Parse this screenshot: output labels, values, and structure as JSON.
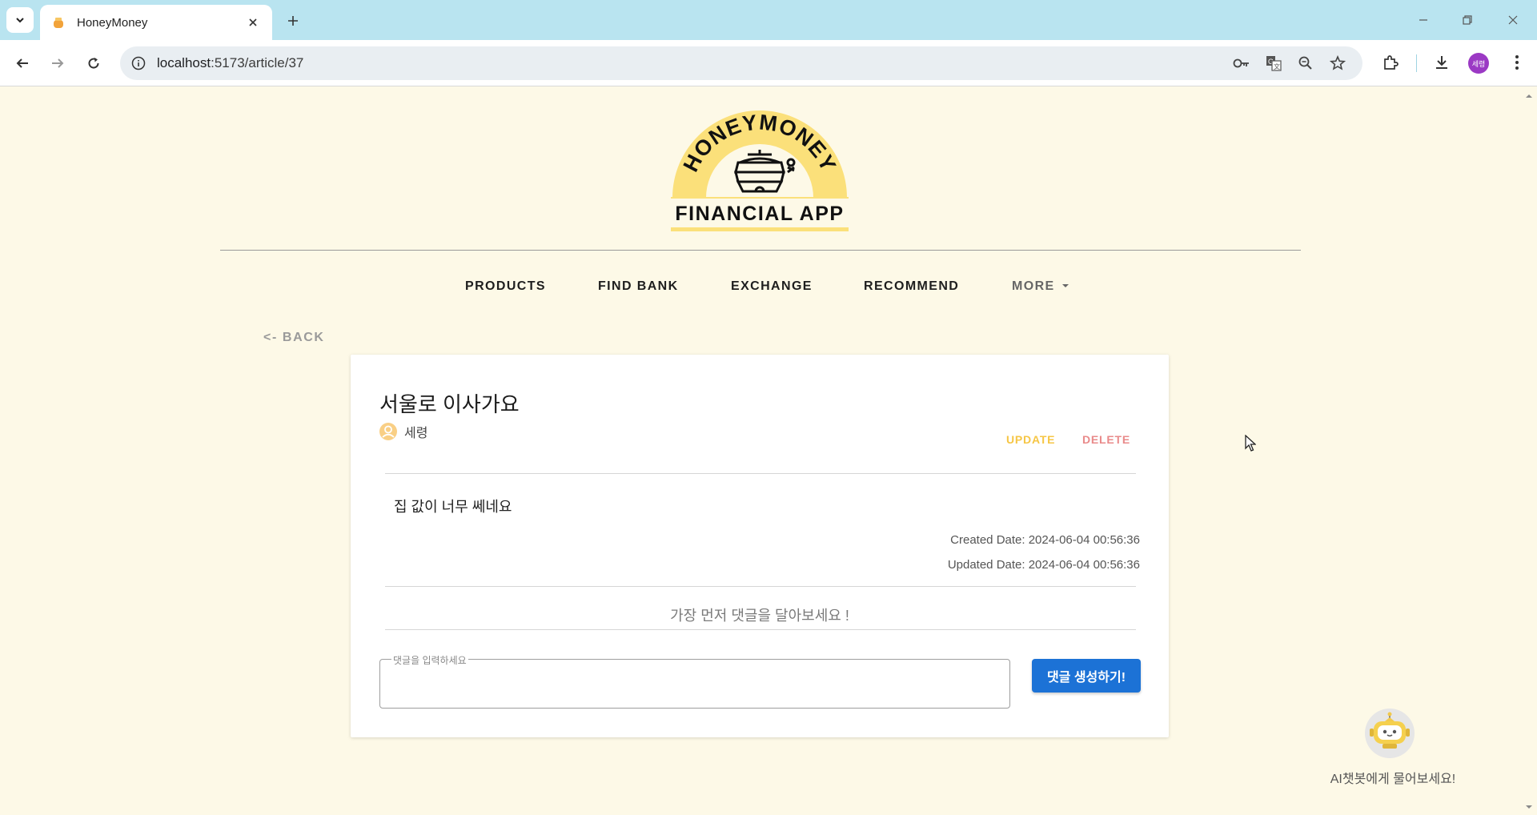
{
  "browser": {
    "tab_title": "HoneyMoney",
    "url_host": "localhost",
    "url_path": ":5173/article/37",
    "profile_initial": "세령"
  },
  "site": {
    "logo_top_text": "HONEYMONEY",
    "logo_bottom_text": "FINANCIAL APP",
    "nav": {
      "products": "PRODUCTS",
      "find_bank": "FIND BANK",
      "exchange": "EXCHANGE",
      "recommend": "RECOMMEND",
      "more": "MORE"
    },
    "back_label": "<- BACK"
  },
  "article": {
    "title": "서울로 이사가요",
    "author": "세령",
    "update_label": "UPDATE",
    "delete_label": "DELETE",
    "content": "집 값이 너무 쎄네요",
    "created": "Created Date: 2024-06-04 00:56:36",
    "updated": "Updated Date: 2024-06-04 00:56:36"
  },
  "comments": {
    "empty_message": "가장 먼저 댓글을 달아보세요 !",
    "input_label": "댓글을 입력하세요",
    "submit_label": "댓글 생성하기!"
  },
  "chatbot": {
    "label": "AI챗봇에게 물어보세요!"
  },
  "colors": {
    "page_bg": "#fdf9e7",
    "honey_yellow": "#f6c645",
    "delete_red": "#e98a8a",
    "primary_blue": "#1c72d6",
    "tabbar_bg": "#b9e4f0"
  }
}
